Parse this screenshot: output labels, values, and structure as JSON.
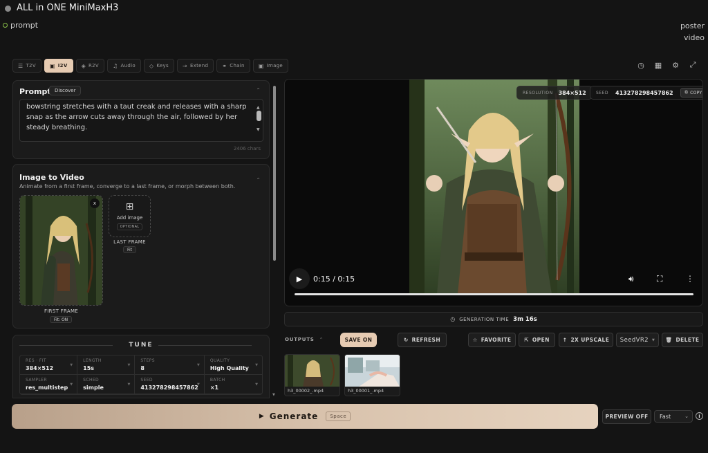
{
  "app": {
    "title": "ALL in ONE MiniMaxH3",
    "status": "prompt"
  },
  "header_links": [
    "poster",
    "video"
  ],
  "mode_tabs": [
    {
      "icon": "list-icon",
      "label": "T2V"
    },
    {
      "icon": "image-icon",
      "label": "I2V"
    },
    {
      "icon": "layers-icon",
      "label": "R2V"
    },
    {
      "icon": "audio-icon",
      "label": "Audio"
    },
    {
      "icon": "diamond-icon",
      "label": "Keys"
    },
    {
      "icon": "arrow-right-icon",
      "label": "Extend"
    },
    {
      "icon": "link-icon",
      "label": "Chain"
    },
    {
      "icon": "image-icon",
      "label": "Image"
    }
  ],
  "active_tab": "I2V",
  "top_icons": [
    "history-icon",
    "grid-icon",
    "gear-icon",
    "expand-icon"
  ],
  "prompt": {
    "title": "Prompt",
    "discover_label": "Discover",
    "text": "bowstring stretches with a taut creak and releases with a sharp snap as the arrow cuts away through the air, followed by her steady breathing.\n\nnon_diegetic_music: N/A",
    "char_count": "2406 chars"
  },
  "i2v": {
    "title": "Image to Video",
    "subtitle": "Animate from a first frame, converge to a last frame, or morph between both.",
    "first_frame_label": "FIRST FRAME",
    "first_frame_badge": "Fit: ON",
    "remove_label": "x",
    "add_image_label": "Add image",
    "optional_label": "OPTIONAL",
    "last_frame_label": "LAST FRAME",
    "last_frame_badge": "Fit"
  },
  "tune": {
    "title": "TUNE",
    "cells": [
      {
        "label": "RES · FIT",
        "value": "384×512"
      },
      {
        "label": "LENGTH",
        "value": "15s"
      },
      {
        "label": "STEPS",
        "value": "8"
      },
      {
        "label": "QUALITY",
        "value": "High Quality"
      },
      {
        "label": "SAMPLER",
        "value": "res_multistep"
      },
      {
        "label": "SCHED",
        "value": "simple"
      },
      {
        "label": "SEED",
        "value": "413278298457862"
      },
      {
        "label": "BATCH",
        "value": "×1"
      }
    ]
  },
  "video": {
    "resolution_label": "RESOLUTION",
    "resolution_value": "384×512",
    "seed_label": "SEED",
    "seed_value": "413278298457862",
    "copy_label": "COPY",
    "time": "0:15 / 0:15",
    "progress": 1.0
  },
  "generation": {
    "label": "GENERATION TIME",
    "value": "3m 16s"
  },
  "outputs": {
    "label": "OUTPUTS",
    "save_label": "SAVE ON",
    "refresh_label": "REFRESH",
    "favorite_label": "FAVORITE",
    "open_label": "OPEN",
    "upscale_label": "2X UPSCALE",
    "upscaler_value": "SeedVR2",
    "delete_label": "DELETE",
    "items": [
      {
        "name": "h3_00002_.mp4"
      },
      {
        "name": "h3_00001_.mp4"
      }
    ]
  },
  "generate": {
    "label": "Generate",
    "shortcut": "Space"
  },
  "preview_label": "PREVIEW OFF",
  "speed": {
    "value": "Fast"
  },
  "info_label": "i",
  "colors": {
    "accent": "#e6cbb2",
    "background": "#141414",
    "panel": "#1b1b1b",
    "status_ok": "#8bc34a"
  }
}
